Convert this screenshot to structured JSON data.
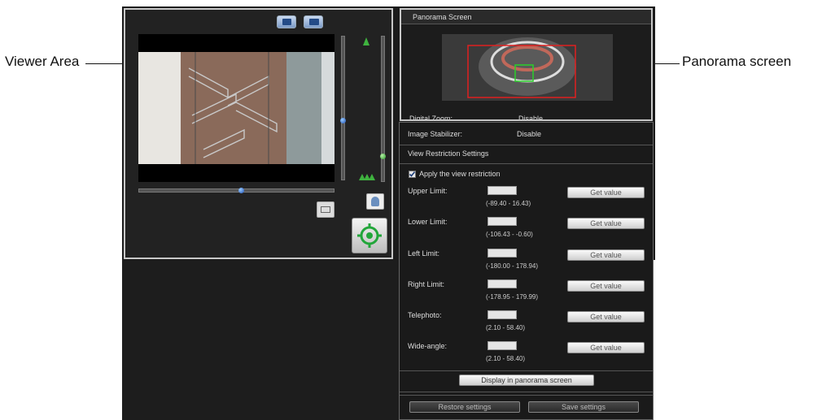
{
  "callouts": {
    "viewer": "Viewer Area",
    "panorama": "Panorama screen"
  },
  "panorama": {
    "title": "Panorama Screen",
    "hidden_label": "Digital Zoom:",
    "hidden_value": "Disable"
  },
  "settings": {
    "stabilizer_label": "Image Stabilizer:",
    "stabilizer_value": "Disable",
    "restriction_header": "View Restriction Settings",
    "apply_label": "Apply the view restriction",
    "apply_checked": true,
    "limits": [
      {
        "label": "Upper Limit:",
        "range": "(-89.40 - 16.43)",
        "button": "Get value"
      },
      {
        "label": "Lower Limit:",
        "range": "(-106.43 - -0.60)",
        "button": "Get value"
      },
      {
        "label": "Left Limit:",
        "range": "(-180.00 - 178.94)",
        "button": "Get value"
      },
      {
        "label": "Right Limit:",
        "range": "(-178.95 - 179.99)",
        "button": "Get value"
      },
      {
        "label": "Telephoto:",
        "range": "(2.10 - 58.40)",
        "button": "Get value"
      },
      {
        "label": "Wide-angle:",
        "range": "(2.10 - 58.40)",
        "button": "Get value"
      }
    ],
    "display_button": "Display in panorama screen",
    "restore_button": "Restore settings",
    "save_button": "Save settings"
  },
  "sliders": {
    "pan_position": 0.52,
    "tilt_position": 0.57,
    "zoom_position": 0.9
  },
  "icons": {
    "snapshot": "camera-icon",
    "switch": "view-switch-icon",
    "person": "person-icon",
    "center": "target-icon",
    "zoom_in": "zoom-in-icon",
    "zoom_out": "zoom-out-icon",
    "window": "window-icon"
  }
}
